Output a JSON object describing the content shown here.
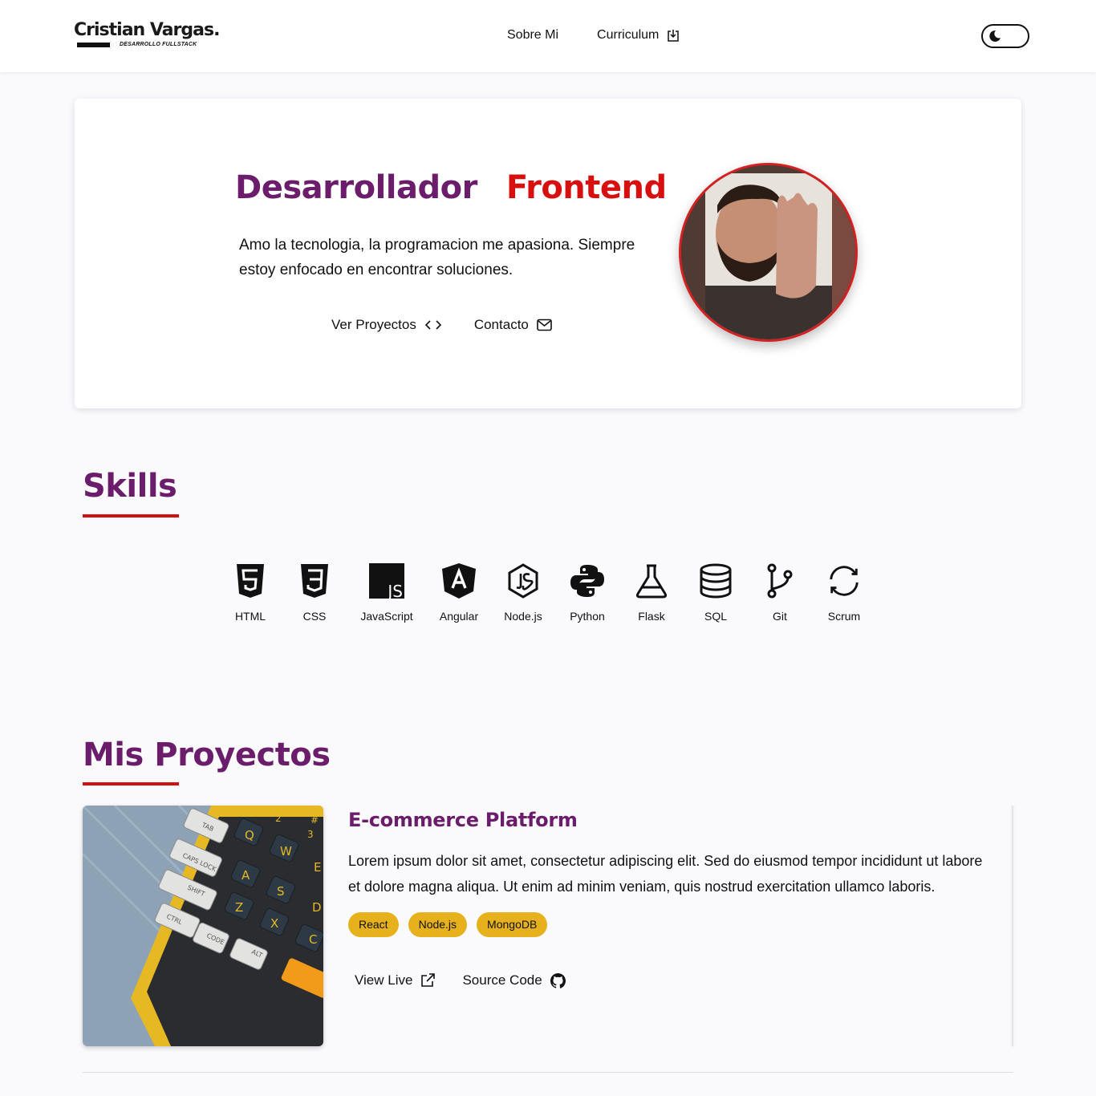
{
  "header": {
    "logo": {
      "name": "Cristian Vargas.",
      "subtitle": "DESARROLLO FULLSTACK"
    },
    "nav": [
      {
        "label": "Sobre Mi",
        "icon": null
      },
      {
        "label": "Curriculum",
        "icon": "download-icon"
      }
    ],
    "theme_toggle": {
      "icon": "moon-icon"
    }
  },
  "hero": {
    "title_part1": "Desarrollador",
    "title_part2": "Frontend",
    "description": "Amo la tecnologia, la programacion me apasiona. Siempre estoy enfocado en encontrar soluciones.",
    "actions": [
      {
        "label": "Ver Proyectos",
        "icon": "code-icon"
      },
      {
        "label": "Contacto",
        "icon": "mail-icon"
      }
    ],
    "avatar": {
      "image": "profile-photo"
    }
  },
  "skills": {
    "title": "Skills",
    "items": [
      {
        "label": "HTML",
        "icon": "html5-icon"
      },
      {
        "label": "CSS",
        "icon": "css3-icon"
      },
      {
        "label": "JavaScript",
        "icon": "javascript-icon"
      },
      {
        "label": "Angular",
        "icon": "angular-icon"
      },
      {
        "label": "Node.js",
        "icon": "nodejs-icon"
      },
      {
        "label": "Python",
        "icon": "python-icon"
      },
      {
        "label": "Flask",
        "icon": "flask-icon"
      },
      {
        "label": "SQL",
        "icon": "database-icon"
      },
      {
        "label": "Git",
        "icon": "git-branch-icon"
      },
      {
        "label": "Scrum",
        "icon": "refresh-icon"
      }
    ]
  },
  "projects": {
    "title": "Mis Proyectos",
    "items": [
      {
        "title": "E-commerce Platform",
        "description": "Lorem ipsum dolor sit amet, consectetur adipiscing elit. Sed do eiusmod tempor incididunt ut labore et dolore magna aliqua. Ut enim ad minim veniam, quis nostrud exercitation ullamco laboris.",
        "tags": [
          "React",
          "Node.js",
          "MongoDB"
        ],
        "links": [
          {
            "label": "View Live",
            "icon": "external-link-icon"
          },
          {
            "label": "Source Code",
            "icon": "github-icon"
          }
        ],
        "image": {
          "keys": [
            "TAB",
            "CAPS LOCK",
            "SHIFT",
            "CTRL",
            "CODE",
            "ALT",
            "Q",
            "W",
            "E",
            "A",
            "S",
            "D",
            "Z",
            "X",
            "C",
            "2",
            "3",
            "@",
            "#"
          ]
        }
      }
    ]
  },
  "colors": {
    "accent_purple": "#6b1d6b",
    "accent_red": "#d80f0f",
    "tag_yellow": "#e6b11d",
    "background": "#fafafd"
  }
}
